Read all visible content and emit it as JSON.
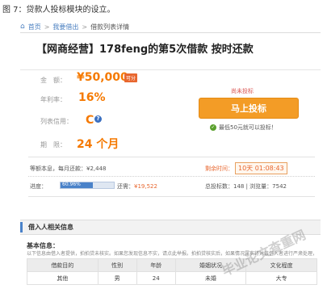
{
  "caption": "图 7：贷款人投标模块的设立。",
  "breadcrumb": {
    "home": "首页",
    "sep": ">",
    "borrow": "我要借出",
    "detail": "借款列表详情"
  },
  "loan": {
    "title": "【网商经营】178feng的第5次借款 按时还款",
    "amount_label": "金　额：",
    "amount_value": "¥50,000",
    "amount_badge": "可分",
    "rate_label": "年利率：",
    "rate_value": "16%",
    "credit_label": "列表信用：",
    "credit_value": "C",
    "term_label": "期　限：",
    "term_value": "24 个月"
  },
  "side": {
    "status": "尚未投标",
    "invest_button": "马上投标",
    "min_note": "最低50元就可以投标！"
  },
  "stats": {
    "repay_text": "等额本息，每月还款：¥2,448",
    "countdown_label": "剩余时间：",
    "countdown_value": "10天 01:08:43",
    "progress_label": "进度：",
    "progress_percent": 60.96,
    "progress_text": "60.96%",
    "remain_label": "还需：",
    "remain_value": "¥19,522",
    "bids_text": "总投标数：148 | 浏览量：7542"
  },
  "section": {
    "title": "借入人相关信息",
    "basic_title": "基本信息：",
    "notice": "以下信息由借入者提供，拍拍贷未核实。如果您发现信息不实，请点此举报。拍拍贷核实后，如果情况属实将对该借入者进行严肃处理，并给予举报者适当奖励。"
  },
  "table": {
    "headers": [
      "借款目的",
      "性别",
      "年龄",
      "婚姻状况",
      "文化程度"
    ],
    "row": [
      "其他",
      "男",
      "24",
      "未婚",
      "大专"
    ]
  },
  "watermark": "毕业论文查重网",
  "colors": {
    "accent": "#f57900",
    "button": "#f39c26",
    "link": "#4a7fc0",
    "progress": "#4a82c9"
  }
}
